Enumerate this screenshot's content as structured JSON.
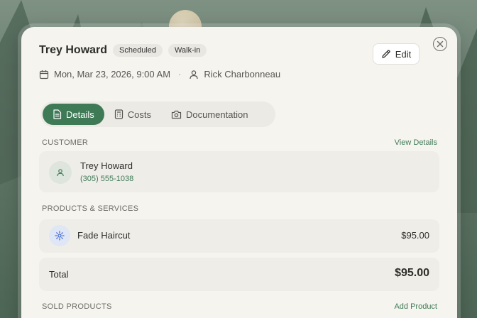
{
  "appointment": {
    "customer_name": "Trey Howard",
    "badges": [
      "Scheduled",
      "Walk-in"
    ],
    "edit_label": "Edit",
    "datetime": "Mon, Mar 23, 2026, 9:00 AM",
    "separator": "·",
    "staff": "Rick Charbonneau"
  },
  "tabs": [
    {
      "label": "Details",
      "active": true
    },
    {
      "label": "Costs",
      "active": false
    },
    {
      "label": "Documentation",
      "active": false
    }
  ],
  "customer_section": {
    "label": "CUSTOMER",
    "link": "View Details",
    "name": "Trey Howard",
    "phone": "(305) 555-1038"
  },
  "products_section": {
    "label": "PRODUCTS & SERVICES",
    "items": [
      {
        "name": "Fade Haircut",
        "price": "$95.00"
      }
    ],
    "total_label": "Total",
    "total_value": "$95.00"
  },
  "sold_section": {
    "label": "SOLD PRODUCTS",
    "link": "Add Product"
  },
  "colors": {
    "accent": "#3f7a57",
    "modal_bg": "#f6f4ef",
    "card_bg": "#efede8"
  }
}
